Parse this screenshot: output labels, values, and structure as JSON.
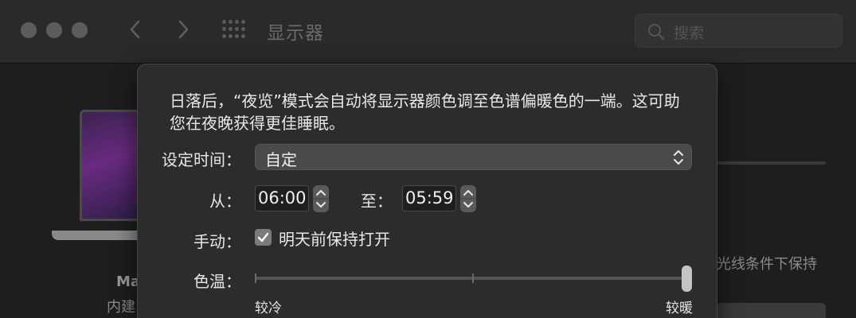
{
  "window": {
    "title": "显示器",
    "search_placeholder": "搜索"
  },
  "background": {
    "device_name_partial": "Ma",
    "device_type_partial": "内建",
    "right_text_partial": "光线条件下保持"
  },
  "sheet": {
    "description": "日落后，“夜览”模式会自动将显示器颜色调至色谱偏暖色的一端。这可助您在夜晚获得更佳睡眠。",
    "schedule_label": "设定时间：",
    "schedule_value": "自定",
    "from_label": "从：",
    "from_time": "06:00",
    "to_label": "至：",
    "to_time": "05:59",
    "manual_label": "手动：",
    "manual_checkbox_label": "明天前保持打开",
    "manual_checked": true,
    "temp_label": "色温：",
    "temp_min_label": "较冷",
    "temp_max_label": "较暖",
    "temp_value_fraction": 1.0
  },
  "colors": {
    "sheet_bg": "#2c2c2c",
    "window_bg": "#1e1e1e",
    "checkbox": "#7b7b7b"
  }
}
